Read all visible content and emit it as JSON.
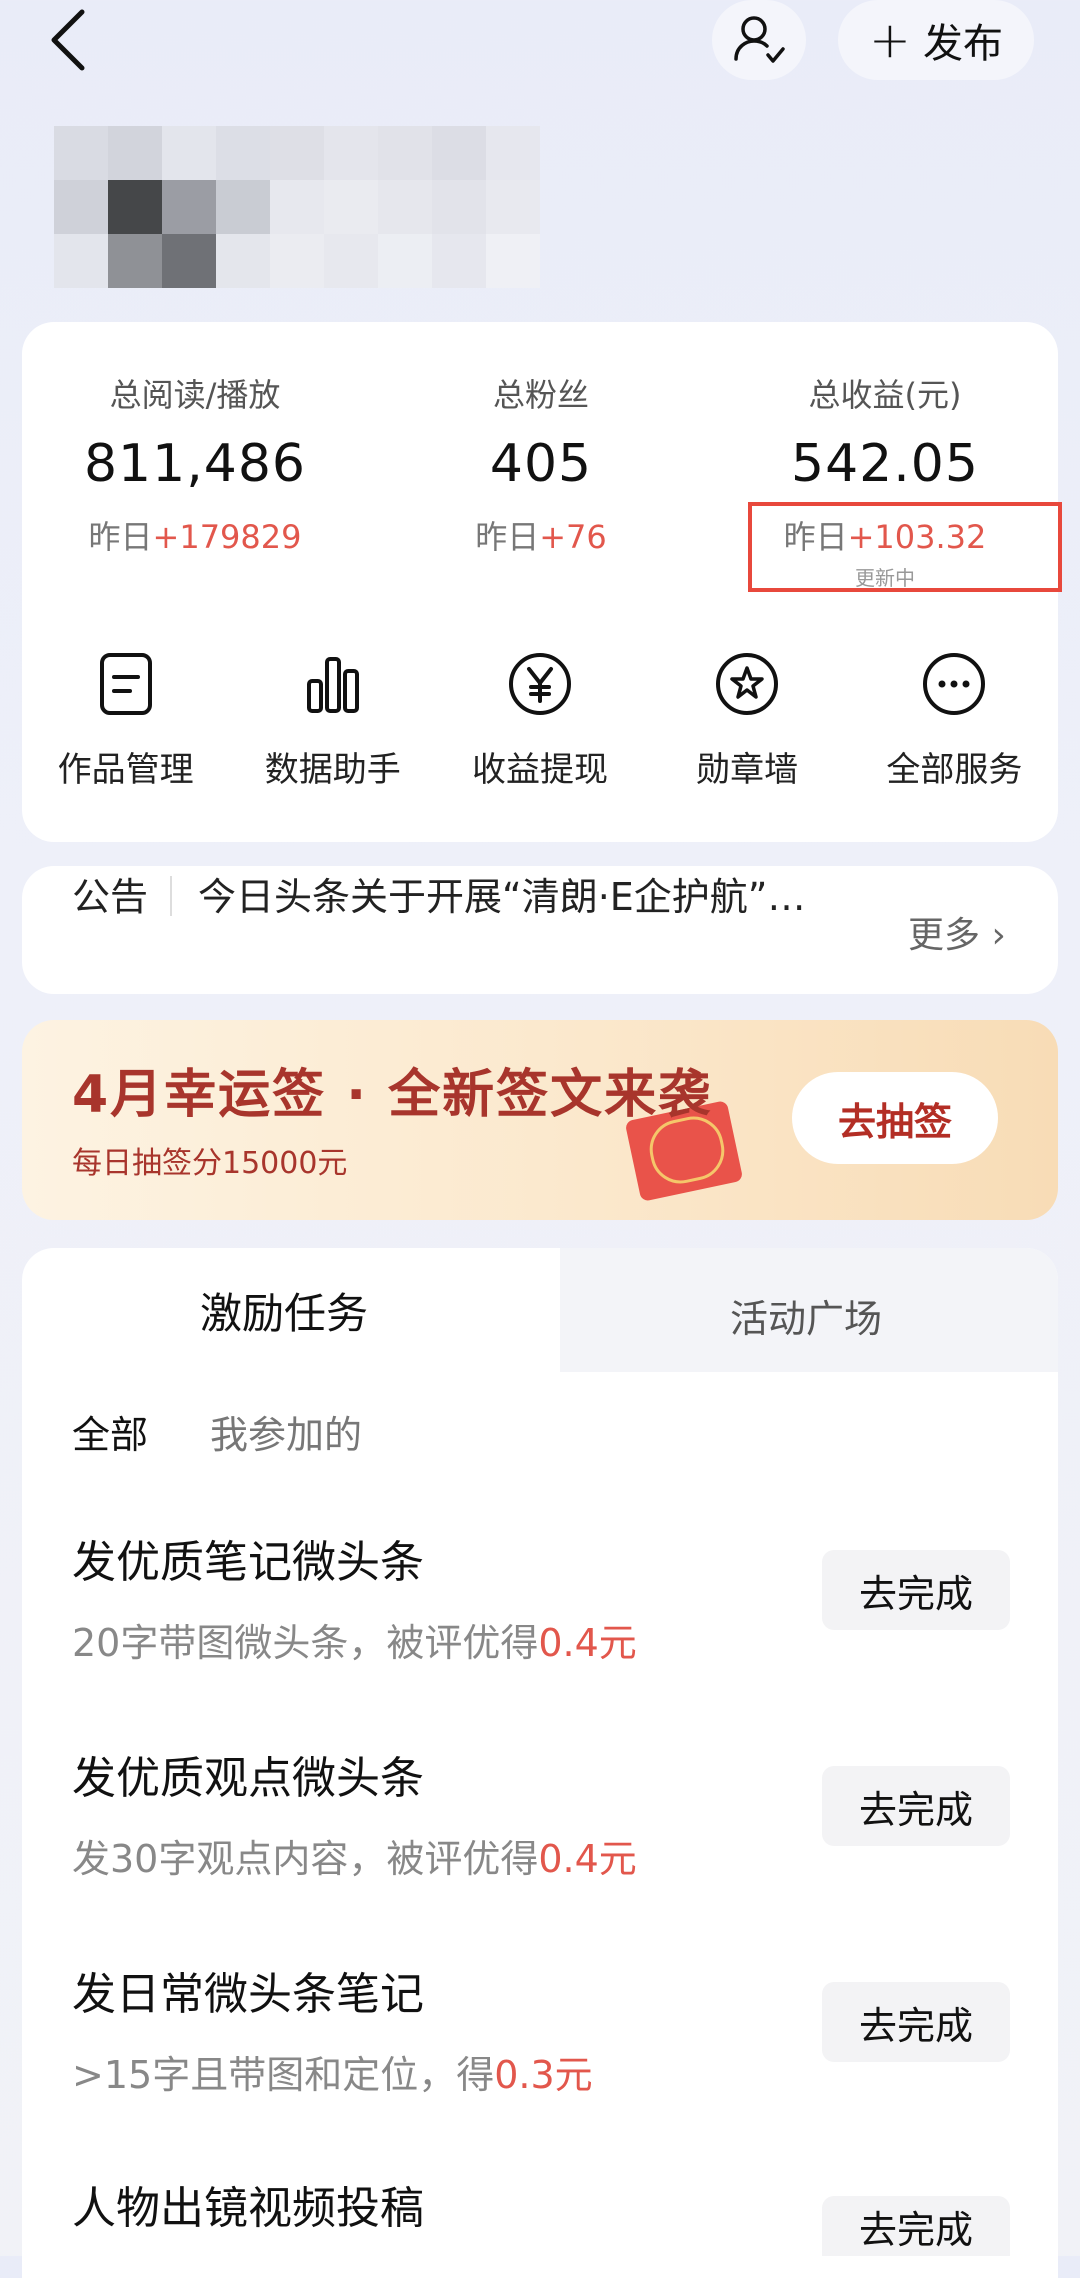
{
  "header": {
    "publish_label": "发布"
  },
  "stats": [
    {
      "label": "总阅读/播放",
      "value": "811,486",
      "yday_prefix": "昨日",
      "yday_delta": "+179829"
    },
    {
      "label": "总粉丝",
      "value": "405",
      "yday_prefix": "昨日",
      "yday_delta": "+76"
    },
    {
      "label": "总收益(元)",
      "value": "542.05",
      "yday_prefix": "昨日",
      "yday_delta": "+103.32",
      "status": "更新中"
    }
  ],
  "services": [
    {
      "label": "作品管理",
      "icon": "document-icon"
    },
    {
      "label": "数据助手",
      "icon": "bar-chart-icon"
    },
    {
      "label": "收益提现",
      "icon": "yen-icon"
    },
    {
      "label": "勋章墙",
      "icon": "medal-icon"
    },
    {
      "label": "全部服务",
      "icon": "more-icon"
    }
  ],
  "notice": {
    "title": "公告",
    "text": "今日头条关于开展“清朗·E企护航”…",
    "more": "更多"
  },
  "banner": {
    "title": "4月幸运签 · 全新签文来袭",
    "subtitle": "每日抽签分15000元",
    "button": "去抽签"
  },
  "tabs": [
    {
      "label": "激励任务",
      "active": true
    },
    {
      "label": "活动广场",
      "active": false
    }
  ],
  "filters": [
    {
      "label": "全部",
      "active": true
    },
    {
      "label": "我参加的",
      "active": false
    }
  ],
  "tasks": [
    {
      "title": "发优质笔记微头条",
      "desc": "20字带图微头条，被评优得",
      "reward": "0.4元",
      "button": "去完成"
    },
    {
      "title": "发优质观点微头条",
      "desc": "发30字观点内容，被评优得",
      "reward": "0.4元",
      "button": "去完成"
    },
    {
      "title": "发日常微头条笔记",
      "desc": ">15字且带图和定位，得",
      "reward": "0.3元",
      "button": "去完成"
    },
    {
      "title": "人物出镜视频投稿",
      "desc": "",
      "reward": "",
      "button": "去完成"
    }
  ],
  "colors": {
    "accent_red": "#e2574c",
    "banner_red": "#a8352c",
    "highlight_box": "#e8483c"
  }
}
